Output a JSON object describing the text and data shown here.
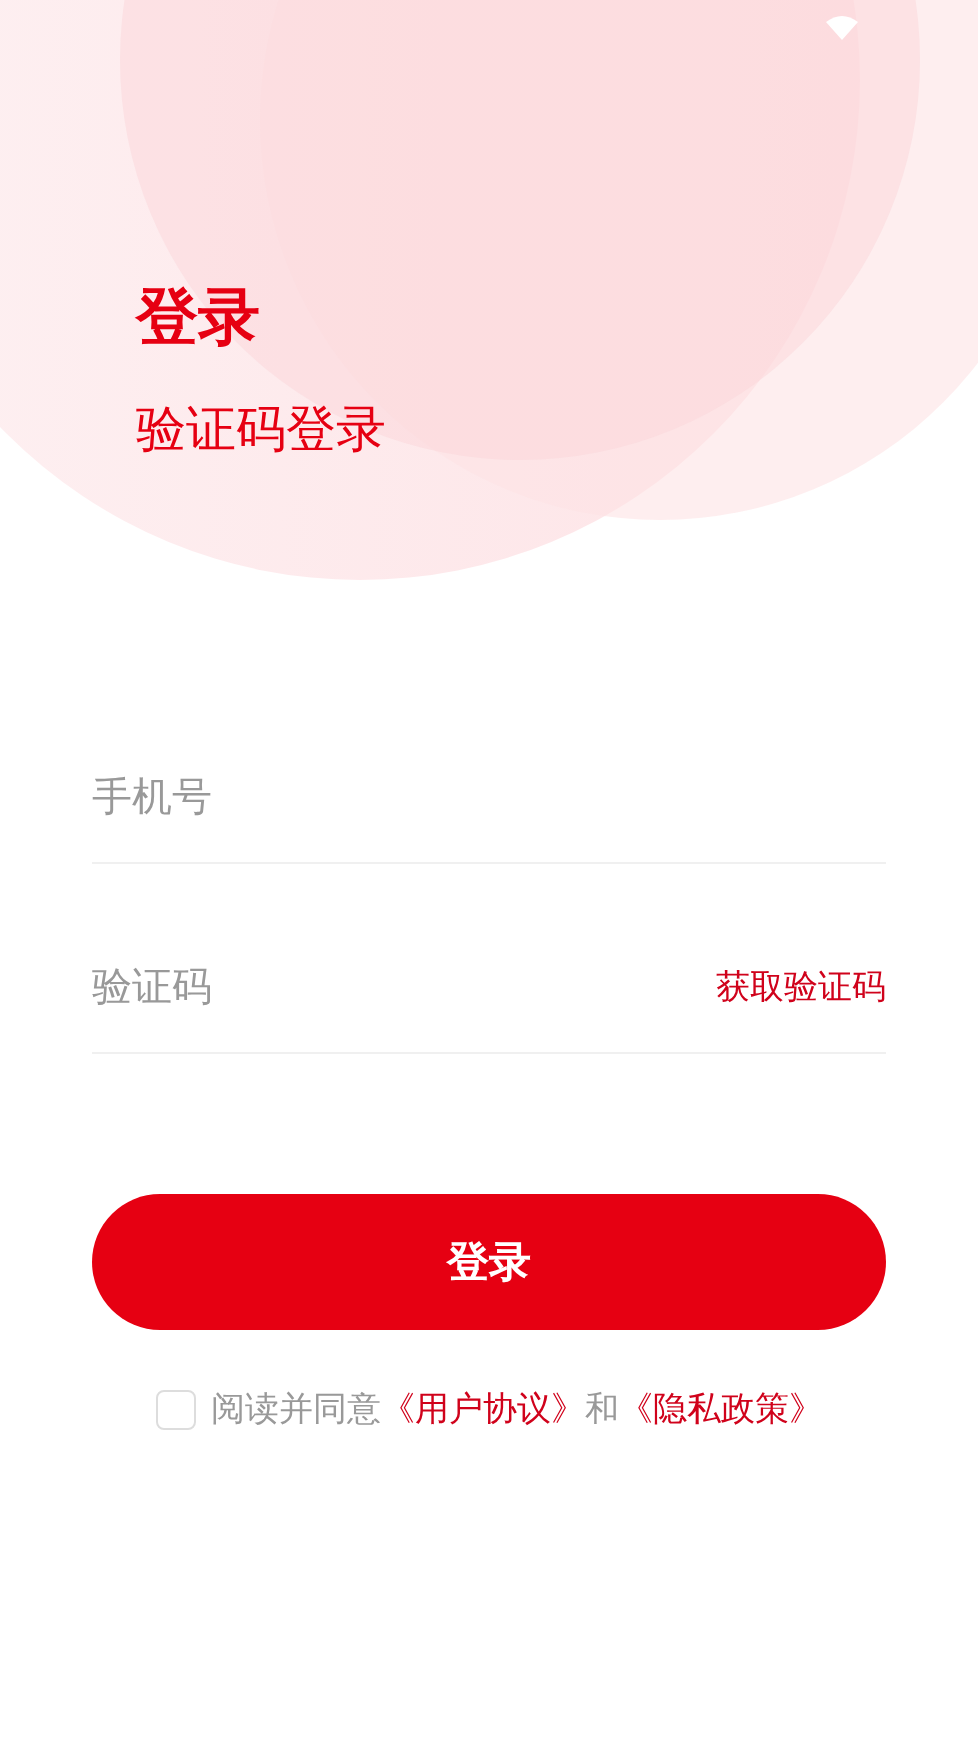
{
  "title": "登录",
  "subtitle": "验证码登录",
  "phone_field": {
    "placeholder": "手机号"
  },
  "code_field": {
    "placeholder": "验证码",
    "action": "获取验证码"
  },
  "login_button": "登录",
  "agreement": {
    "checked": false,
    "parts": [
      {
        "kind": "plain",
        "text": "阅读并同意"
      },
      {
        "kind": "link",
        "text": "《用户协议》"
      },
      {
        "kind": "plain",
        "text": "和"
      },
      {
        "kind": "link",
        "text": "《隐私政策》"
      }
    ]
  }
}
